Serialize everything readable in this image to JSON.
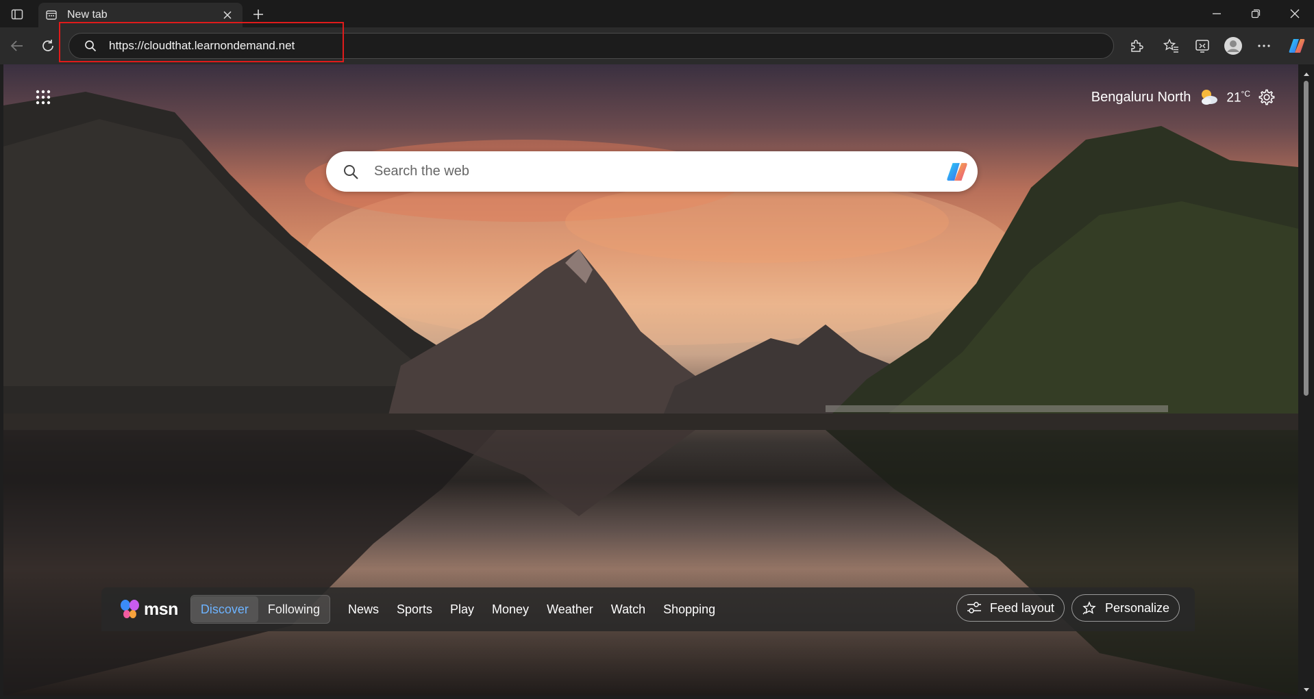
{
  "tab": {
    "title": "New tab"
  },
  "address_bar": {
    "url": "https://cloudthat.learnondemand.net"
  },
  "weather": {
    "location": "Bengaluru North",
    "temp": "21",
    "unit": "°C"
  },
  "search": {
    "placeholder": "Search the web"
  },
  "msn": {
    "logo_text": "msn",
    "feed_tabs": [
      "Discover",
      "Following"
    ],
    "active_tab": "Discover",
    "nav_links": [
      "News",
      "Sports",
      "Play",
      "Money",
      "Weather",
      "Watch",
      "Shopping"
    ],
    "feed_layout_label": "Feed layout",
    "personalize_label": "Personalize"
  },
  "colors": {
    "highlight": "#e01b1b",
    "active_tab": "#6db3ff"
  }
}
